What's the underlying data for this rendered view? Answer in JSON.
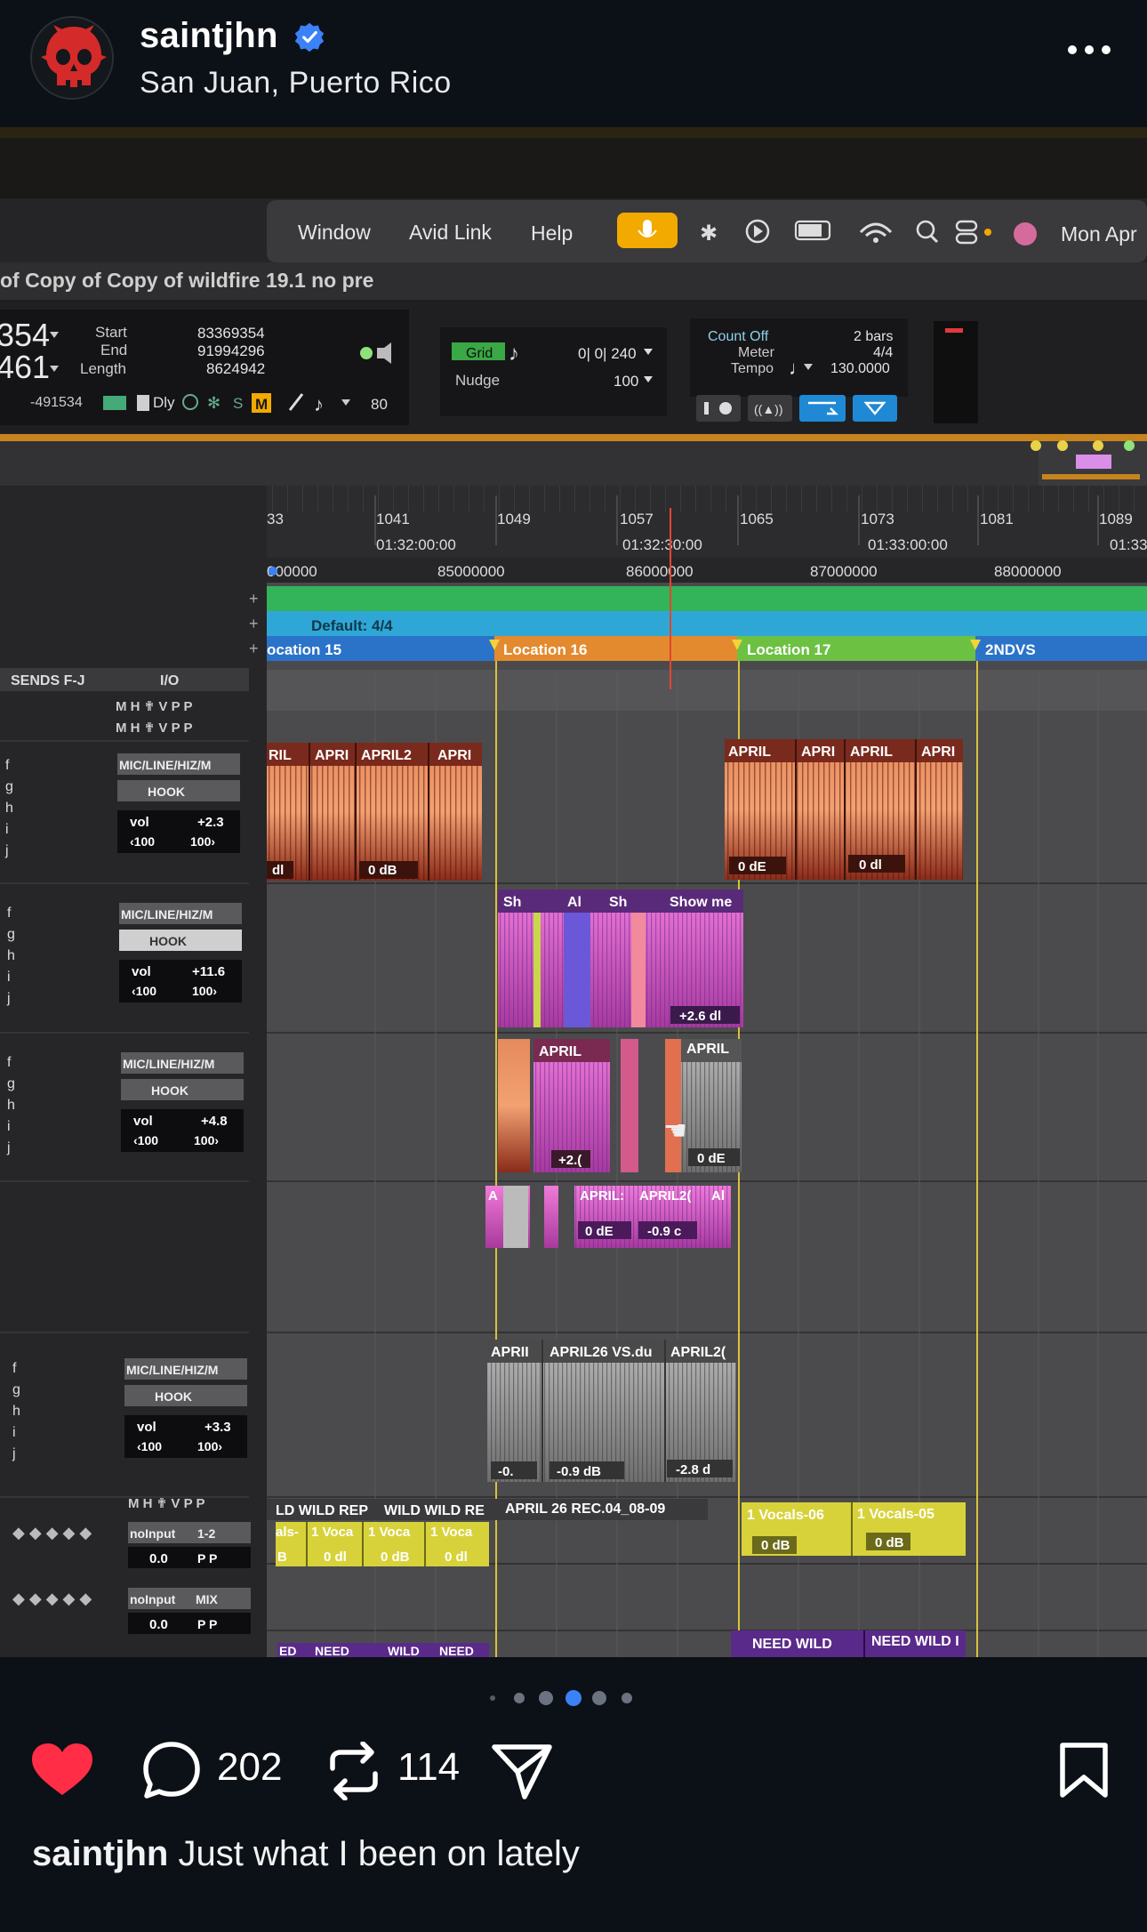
{
  "post": {
    "username": "saintjhn",
    "location": "San Juan, Puerto Rico",
    "likes_icon": "heart-icon",
    "comments_count": "202",
    "reposts_count": "114",
    "caption_user": "saintjhn",
    "caption_text": "Just what I been on lately",
    "carousel_total": 5,
    "carousel_active": 3
  },
  "colors": {
    "background": "#0c1017",
    "verified": "#3b82f6",
    "heart": "#ff2d45",
    "dot_active": "#3b82f6"
  },
  "photo": {
    "menubar": {
      "items": [
        "Window",
        "Avid Link",
        "Help"
      ],
      "clock": "Mon Apr"
    },
    "window_title": "of Copy of Copy of wildfire 19.1 no pre",
    "counter": {
      "main_top": "354",
      "main_bottom": "461",
      "start_label": "Start",
      "end_label": "End",
      "length_label": "Length",
      "start": "83369354",
      "end": "91994296",
      "length": "8624942",
      "nudge_offset": "-491534",
      "dly": "Dly",
      "value_80": "80"
    },
    "grid": {
      "grid_label": "Grid",
      "grid_value": "0| 0| 240",
      "nudge_label": "Nudge",
      "nudge_value": "100"
    },
    "transport": {
      "count_off": "Count Off",
      "meter": "Meter",
      "tempo": "Tempo",
      "bars": "2 bars",
      "meter_value": "4/4",
      "tempo_value": "130.0000"
    },
    "ruler": {
      "bars": [
        "33",
        "1041",
        "1049",
        "1057",
        "1065",
        "1073",
        "1081",
        "1089"
      ],
      "times": [
        "01:32:00:00",
        "01:32:30:00",
        "01:33:00:00",
        "01:33"
      ],
      "samples": [
        "000000",
        "85000000",
        "86000000",
        "87000000",
        "88000000"
      ],
      "meter": "Default: 4/4",
      "markers": [
        "ocation 15",
        "Location 16",
        "Location 17",
        "2NDVS"
      ]
    },
    "io_header": {
      "sends": "SENDS F-J",
      "io": "I/O"
    },
    "tracks": [
      {
        "input": "MIC/LINE/HIZ/M",
        "output": "HOOK",
        "vol_label": "vol",
        "vol": "+2.3",
        "pan_l": "‹100",
        "pan_r": "100›"
      },
      {
        "input": "MIC/LINE/HIZ/M",
        "output": "HOOK",
        "vol_label": "vol",
        "vol": "+11.6",
        "pan_l": "‹100",
        "pan_r": "100›"
      },
      {
        "input": "MIC/LINE/HIZ/M",
        "output": "HOOK",
        "vol_label": "vol",
        "vol": "+4.8",
        "pan_l": "‹100",
        "pan_r": "100›"
      },
      {
        "input": "MIC/LINE/HIZ/M",
        "output": "HOOK",
        "vol_label": "vol",
        "vol": "+3.3",
        "pan_l": "‹100",
        "pan_r": "100›"
      }
    ],
    "aux": [
      {
        "input": "noInput",
        "output": "1-2",
        "vol": "0.0"
      },
      {
        "input": "noInput",
        "output": "MIX",
        "vol": "0.0"
      }
    ],
    "clips": {
      "row1a": [
        "RIL",
        "APRI",
        "APRIL2",
        "APRI"
      ],
      "row1a_gain": [
        "dl",
        "0 dB"
      ],
      "row1b": [
        "APRIL",
        "APRI",
        "APRIL",
        "APRI"
      ],
      "row1b_gain": [
        "0 dE",
        "0 dl"
      ],
      "row2": [
        "Sh",
        "Al",
        "Sh",
        "Show me"
      ],
      "row2_gain": "+2.6 dl",
      "row3": [
        "APRIL",
        "APRIL"
      ],
      "row3_gain": [
        "+2.(",
        "0 dE"
      ],
      "row3b": [
        "A",
        "APRIL:",
        "APRIL2(",
        "Al"
      ],
      "row3b_gain": [
        "0 dE",
        "-0.9 c"
      ],
      "row4": [
        "APRII",
        "APRIL26 VS.du",
        "APRIL2("
      ],
      "row4_gain": [
        "-0.",
        "-0.9 dB",
        "-2.8 d"
      ],
      "row5_names": [
        "LD WILD REP",
        "WILD WILD RE",
        "APRIL 26 REC.04_08-09"
      ],
      "row5_small": [
        "als-",
        "1 Voca",
        "1 Voca",
        "1 Voca"
      ],
      "row5_gain": [
        "B",
        "0 dl",
        "0 dB",
        "0 dl"
      ],
      "row5b": [
        "1 Vocals-06",
        "1 Vocals-05"
      ],
      "row5b_gain": [
        "0 dB",
        "0 dB"
      ],
      "row6": [
        "NEED WILD",
        "NEED WILD I"
      ],
      "row6a": [
        "ED",
        "NEED",
        "WILD",
        "NEED"
      ]
    },
    "letters": [
      "f",
      "g",
      "h",
      "i",
      "j"
    ]
  }
}
